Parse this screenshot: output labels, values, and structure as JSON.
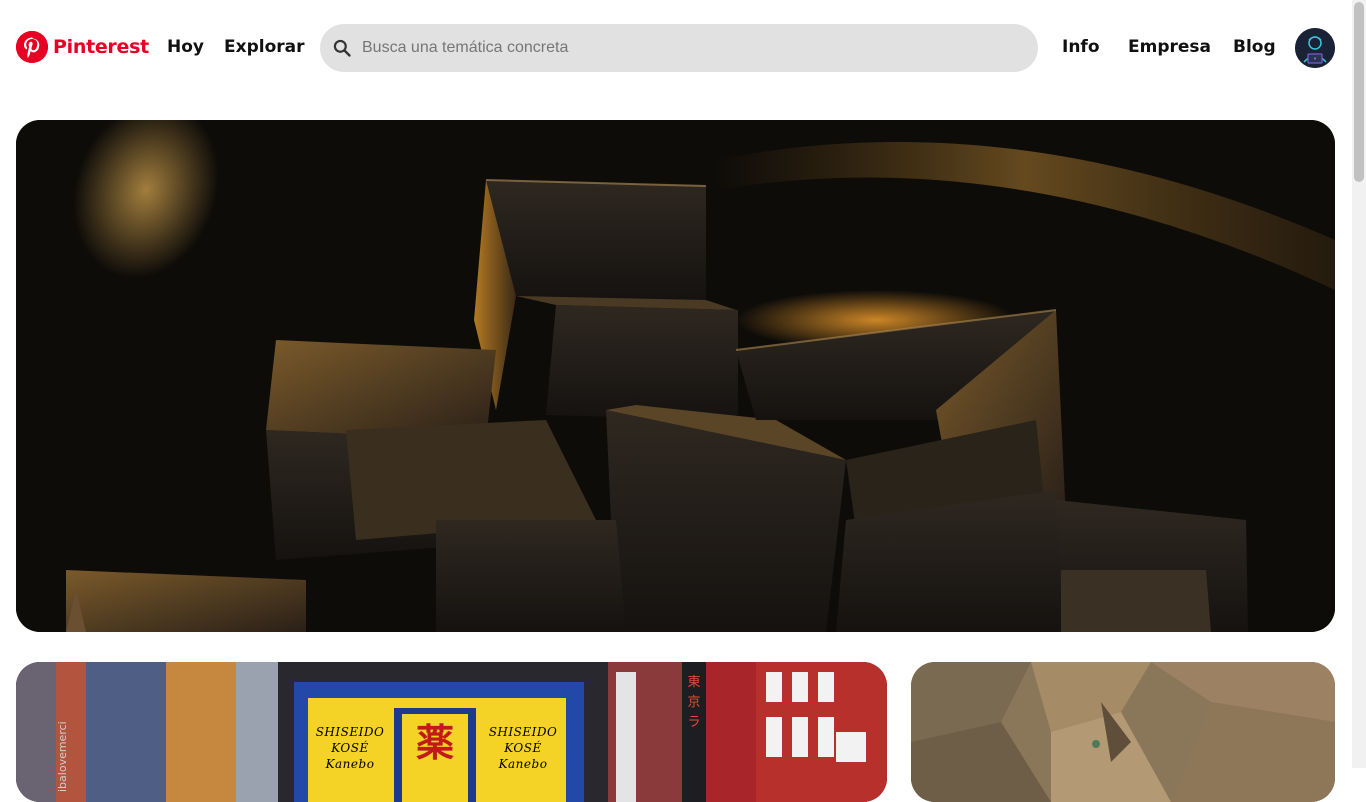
{
  "header": {
    "brand": "Pinterest",
    "nav_left": [
      "Hoy",
      "Explorar"
    ],
    "search": {
      "placeholder": "Busca una temática concreta",
      "value": ""
    },
    "nav_right": [
      "Info",
      "Empresa",
      "Blog"
    ],
    "avatar_icon": "user-avatar"
  },
  "colors": {
    "brand": "#e60023",
    "search_bg": "#e1e1e1",
    "text": "#111111"
  },
  "feed": {
    "hero": {
      "alt": "abstract-geometric-shapes"
    },
    "pins": [
      {
        "kind": "city-street-signs"
      },
      {
        "kind": "rock-cliff"
      }
    ]
  }
}
